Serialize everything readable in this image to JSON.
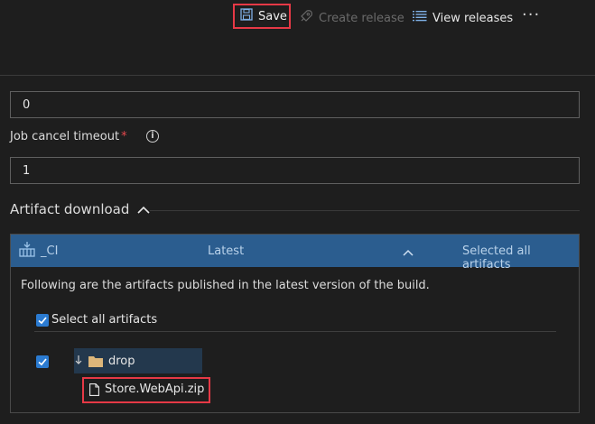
{
  "toolbar": {
    "save_label": "Save",
    "create_release_label": "Create release",
    "view_releases_label": "View releases",
    "more_label": "···"
  },
  "form": {
    "first_value": "0",
    "job_cancel_timeout_label": "Job cancel timeout",
    "required_marker": "*",
    "job_cancel_timeout_value": "1",
    "info_glyph": "i"
  },
  "artifact_download": {
    "section_title": "Artifact download",
    "source_name": "_CI",
    "version": "Latest",
    "selection_status": "Selected all artifacts",
    "description": "Following are the artifacts published in the latest version of the build.",
    "select_all_label": "Select all artifacts",
    "tree": {
      "folder": "drop",
      "file": "Store.WebApi.zip"
    }
  },
  "colors": {
    "accent": "#2b7bd1",
    "header_bg": "#2b5d8f",
    "highlight_border": "#e63946",
    "required": "#e5484d"
  },
  "icons": [
    "save-icon",
    "rocket-icon",
    "list-icon",
    "info-icon",
    "build-icon",
    "chevron-up-icon",
    "checkbox-icon",
    "arrow-down-icon",
    "folder-icon",
    "file-icon"
  ]
}
